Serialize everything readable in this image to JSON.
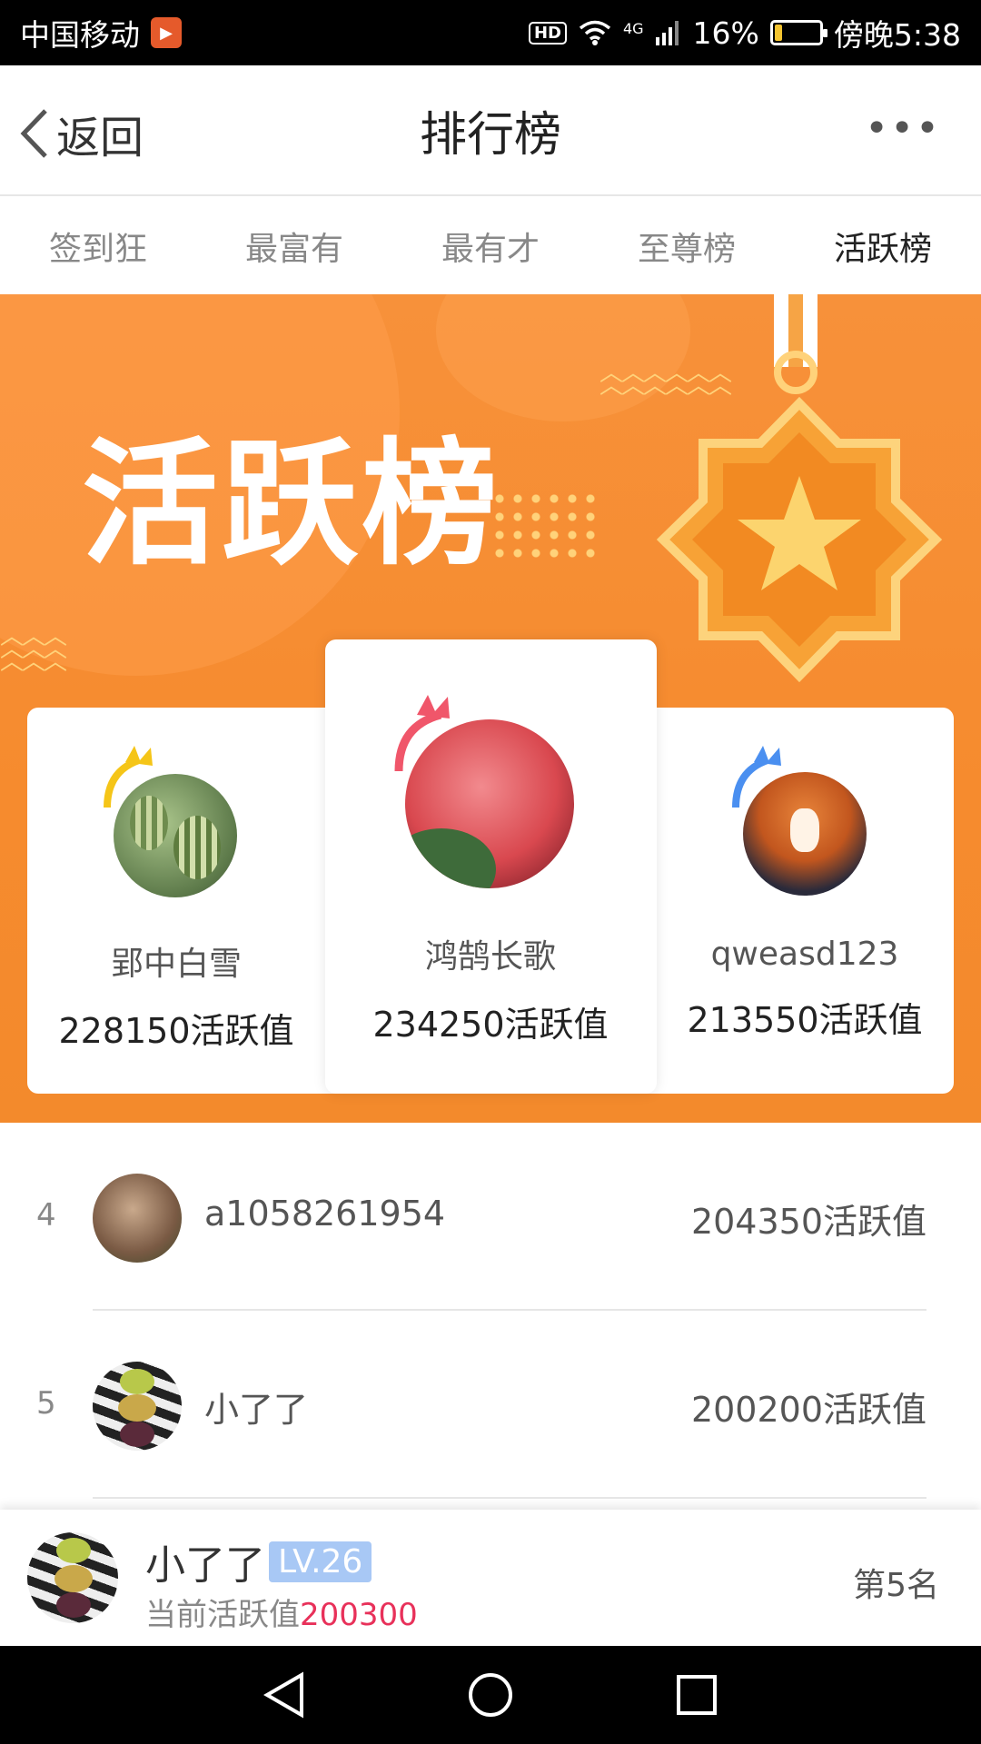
{
  "status_bar": {
    "carrier": "中国移动",
    "network": "4G",
    "hd": "HD",
    "battery": "16%",
    "battery_level": 0.16,
    "time": "傍晚5:38"
  },
  "header": {
    "back_label": "返回",
    "title": "排行榜",
    "more": "•••"
  },
  "tabs": [
    {
      "label": "签到狂",
      "active": false
    },
    {
      "label": "最富有",
      "active": false
    },
    {
      "label": "最有才",
      "active": false
    },
    {
      "label": "至尊榜",
      "active": false
    },
    {
      "label": "活跃榜",
      "active": true
    }
  ],
  "banner": {
    "title": "活跃榜"
  },
  "podium": {
    "first": {
      "name": "鸿鹄长歌",
      "score": "234250活跃值",
      "crown_color": "#f0566a"
    },
    "second": {
      "name": "郢中白雪",
      "score": "228150活跃值",
      "crown_color": "#f5c518"
    },
    "third": {
      "name": "qweasd123",
      "score": "213550活跃值",
      "crown_color": "#4a8ff0"
    }
  },
  "list": [
    {
      "rank": "4",
      "name": "a1058261954",
      "score": "204350活跃值"
    },
    {
      "rank": "5",
      "name": "小了了",
      "score": "200200活跃值"
    }
  ],
  "current_user": {
    "name": "小了了",
    "level": "LV.26",
    "active_label": "当前活跃值",
    "active_value": "200300",
    "rank": "第5名"
  },
  "colors": {
    "banner_orange": "#f68b2e",
    "highlight_red": "#e8315a",
    "level_blue": "#a8c8f5"
  }
}
